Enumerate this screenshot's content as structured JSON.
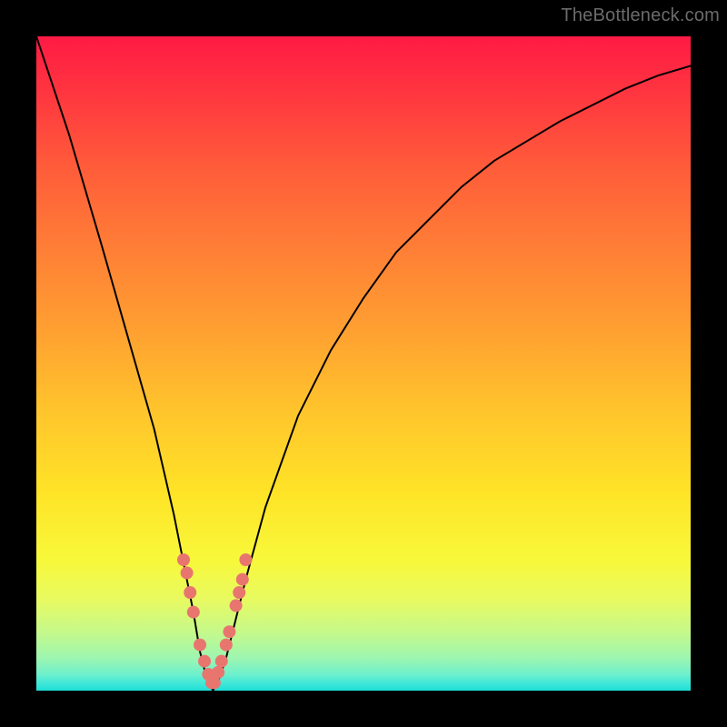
{
  "watermark": "TheBottleneck.com",
  "colors": {
    "frame": "#000000",
    "curve": "#000000",
    "marker": "#e8766f",
    "watermark": "#6b6b6b"
  },
  "chart_data": {
    "type": "line",
    "title": "",
    "xlabel": "",
    "ylabel": "",
    "xlim": [
      0,
      100
    ],
    "ylim": [
      0,
      100
    ],
    "grid": false,
    "legend": false,
    "description": "V-shaped bottleneck curve over rainbow heat gradient (red=high, green=low). Minimum near x≈27.",
    "series": [
      {
        "name": "bottleneck-curve",
        "x": [
          0,
          5,
          10,
          14,
          18,
          21,
          24,
          25,
          26,
          27,
          28,
          29,
          30,
          32,
          35,
          40,
          45,
          50,
          55,
          60,
          65,
          70,
          75,
          80,
          85,
          90,
          95,
          100
        ],
        "y": [
          100,
          85,
          68,
          54,
          40,
          27,
          12,
          6,
          2,
          0,
          2,
          5,
          9,
          17,
          28,
          42,
          52,
          60,
          67,
          72,
          77,
          81,
          84,
          87,
          89.5,
          92,
          94,
          95.5
        ]
      }
    ],
    "markers": {
      "name": "highlighted-points",
      "x": [
        22.5,
        23,
        23.5,
        24,
        25,
        25.7,
        26.3,
        26.8,
        27.2,
        27.8,
        28.3,
        29,
        29.5,
        30.5,
        31,
        31.5,
        32
      ],
      "y": [
        20,
        18,
        15,
        12,
        7,
        4.5,
        2.5,
        1.2,
        1.2,
        2.8,
        4.5,
        7,
        9,
        13,
        15,
        17,
        20
      ]
    }
  }
}
